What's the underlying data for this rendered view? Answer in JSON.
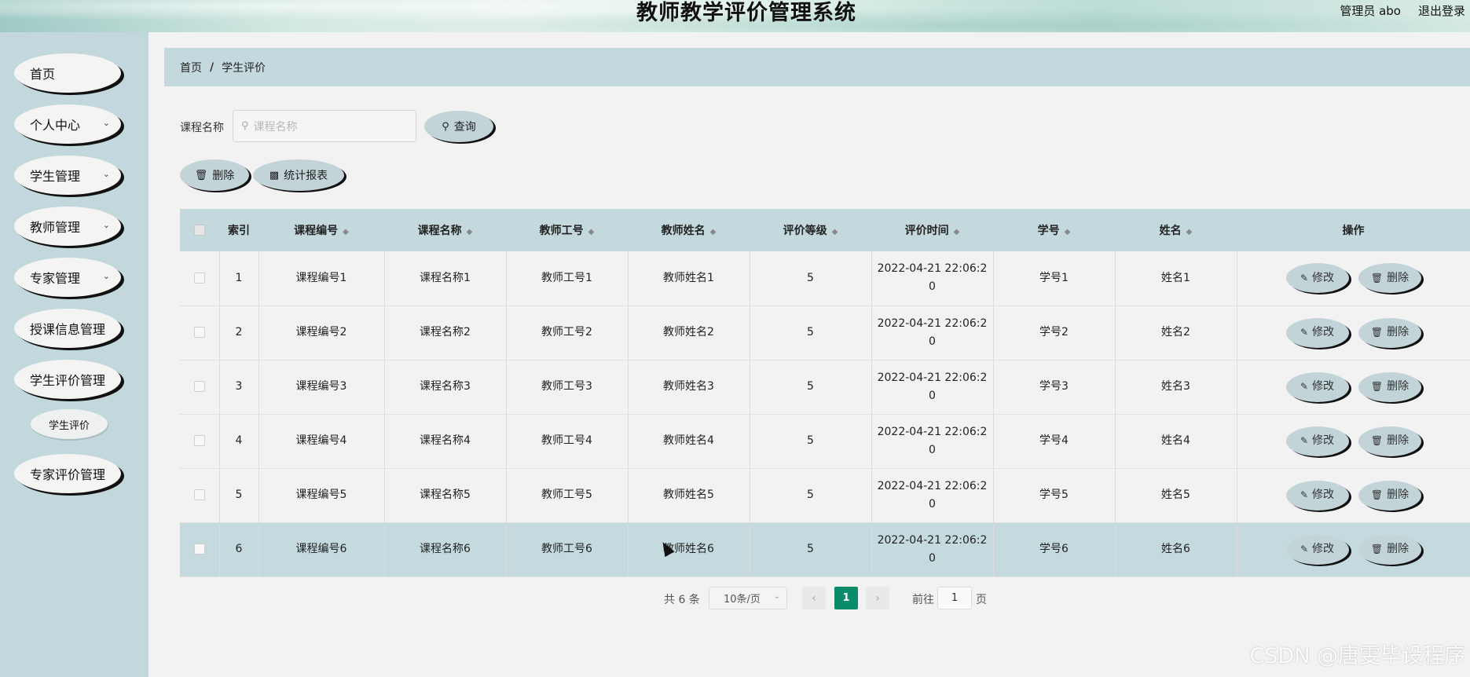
{
  "header": {
    "title": "教师教学评价管理系统",
    "user_label": "管理员 abo",
    "logout_label": "退出登录"
  },
  "sidebar": {
    "items": [
      {
        "label": "首页",
        "expandable": false
      },
      {
        "label": "个人中心",
        "expandable": true
      },
      {
        "label": "学生管理",
        "expandable": true
      },
      {
        "label": "教师管理",
        "expandable": true
      },
      {
        "label": "专家管理",
        "expandable": true
      },
      {
        "label": "授课信息管理",
        "expandable": false
      },
      {
        "label": "学生评价管理",
        "expandable": false
      },
      {
        "label": "专家评价管理",
        "expandable": false
      }
    ],
    "sub_item": "学生评价"
  },
  "breadcrumb": {
    "home": "首页",
    "separator": "/",
    "current": "学生评价"
  },
  "search": {
    "label": "课程名称",
    "placeholder": "课程名称",
    "query_button": "查询"
  },
  "toolbar": {
    "delete_button": "删除",
    "report_button": "统计报表"
  },
  "table": {
    "columns": [
      "索引",
      "课程编号",
      "课程名称",
      "教师工号",
      "教师姓名",
      "评价等级",
      "评价时间",
      "学号",
      "姓名",
      "操作"
    ],
    "edit_label": "修改",
    "delete_label": "删除",
    "rows": [
      {
        "index": "1",
        "course_no": "课程编号1",
        "course_name": "课程名称1",
        "teacher_no": "教师工号1",
        "teacher_name": "教师姓名1",
        "grade": "5",
        "time": "2022-04-21 22:06:20",
        "student_no": "学号1",
        "name": "姓名1"
      },
      {
        "index": "2",
        "course_no": "课程编号2",
        "course_name": "课程名称2",
        "teacher_no": "教师工号2",
        "teacher_name": "教师姓名2",
        "grade": "5",
        "time": "2022-04-21 22:06:20",
        "student_no": "学号2",
        "name": "姓名2"
      },
      {
        "index": "3",
        "course_no": "课程编号3",
        "course_name": "课程名称3",
        "teacher_no": "教师工号3",
        "teacher_name": "教师姓名3",
        "grade": "5",
        "time": "2022-04-21 22:06:20",
        "student_no": "学号3",
        "name": "姓名3"
      },
      {
        "index": "4",
        "course_no": "课程编号4",
        "course_name": "课程名称4",
        "teacher_no": "教师工号4",
        "teacher_name": "教师姓名4",
        "grade": "5",
        "time": "2022-04-21 22:06:20",
        "student_no": "学号4",
        "name": "姓名4"
      },
      {
        "index": "5",
        "course_no": "课程编号5",
        "course_name": "课程名称5",
        "teacher_no": "教师工号5",
        "teacher_name": "教师姓名5",
        "grade": "5",
        "time": "2022-04-21 22:06:20",
        "student_no": "学号5",
        "name": "姓名5"
      },
      {
        "index": "6",
        "course_no": "课程编号6",
        "course_name": "课程名称6",
        "teacher_no": "教师工号6",
        "teacher_name": "教师姓名6",
        "grade": "5",
        "time": "2022-04-21 22:06:20",
        "student_no": "学号6",
        "name": "姓名6"
      }
    ]
  },
  "pagination": {
    "total": "共 6 条",
    "page_size": "10条/页",
    "current_page": "1",
    "goto_label": "前往",
    "goto_value": "1",
    "page_suffix": "页"
  },
  "watermark": "CSDN @唐雯毕设程序",
  "colors": {
    "accent": "#0a8c6b",
    "panel": "#c3d9dd",
    "background": "#f2f2f2"
  }
}
